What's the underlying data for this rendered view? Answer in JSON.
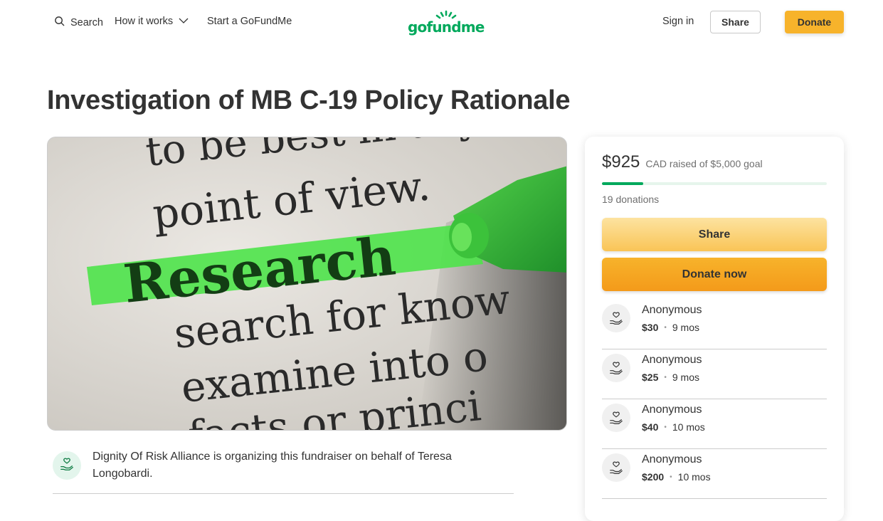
{
  "header": {
    "search_label": "Search",
    "how_it_works_label": "How it works",
    "start_label": "Start a GoFundMe",
    "logo_text": "gofundme",
    "signin_label": "Sign in",
    "share_label": "Share",
    "donate_label": "Donate"
  },
  "campaign": {
    "title": "Investigation of MB C-19 Policy Rationale",
    "image_words": [
      "to be best in any",
      "point of view.",
      "Research",
      "search for know",
      "examine into o",
      "facts or princi"
    ],
    "organizer_text": "Dignity Of Risk Alliance is organizing this fundraiser on behalf of Teresa Longobardi."
  },
  "sidebar": {
    "raised_amount": "$925",
    "raised_goal_text": "CAD raised of $5,000 goal",
    "progress_fraction": 0.185,
    "donation_count": "19 donations",
    "share_label": "Share",
    "donate_now_label": "Donate now",
    "donors": [
      {
        "name": "Anonymous",
        "amount": "$30",
        "time": "9 mos"
      },
      {
        "name": "Anonymous",
        "amount": "$25",
        "time": "9 mos"
      },
      {
        "name": "Anonymous",
        "amount": "$40",
        "time": "10 mos"
      },
      {
        "name": "Anonymous",
        "amount": "$200",
        "time": "10 mos"
      }
    ]
  },
  "colors": {
    "brand_green": "#02a95c",
    "donate_orange": "#f7b32b",
    "share_yellow": "#fde3a0"
  },
  "icons": [
    "search-icon",
    "chevron-down-icon",
    "heart-hand-icon"
  ]
}
